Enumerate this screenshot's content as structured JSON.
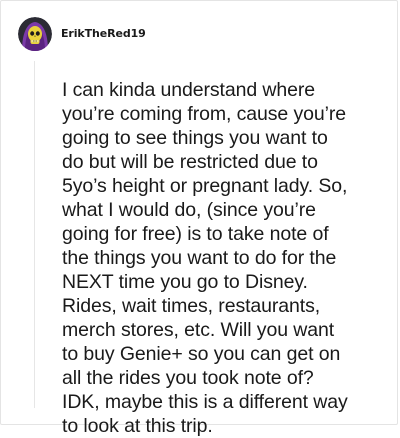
{
  "comment": {
    "username": "ErikTheRed19",
    "avatar_icon": "skeletor-avatar-icon",
    "body": "I can kinda understand where\nyou’re coming from, cause you’re\ngoing to see things you want to\ndo but will be restricted due to\n5yo’s height or pregnant lady. So,\nwhat I would do, (since you’re\ngoing for free) is to take note of\nthe things you want to do for the\nNEXT time you go to Disney.\nRides, wait times, restaurants,\nmerch stores, etc. Will you want\nto buy Genie+ so you can get on\nall the rides you took note of?\nIDK, maybe this is a different way\nto look at this trip."
  },
  "colors": {
    "avatar_background": "#2b2b34",
    "skull": "#e9d33c",
    "hood": "#7b3aa8",
    "text": "#1a1a1a",
    "border": "#e4e4e4"
  }
}
